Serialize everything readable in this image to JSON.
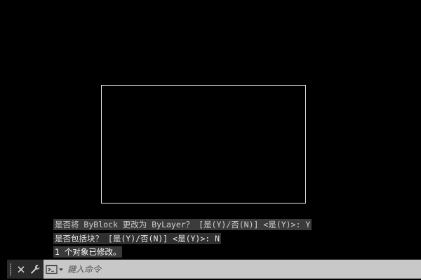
{
  "history": [
    "是否将 ByBlock 更改为 ByLayer？ [是(Y)/否(N)] <是(Y)>: Y",
    "是否包括块？ [是(Y)/否(N)] <是(Y)>: N",
    "1 个对象已修改。"
  ],
  "command_bar": {
    "close_icon": "close-icon",
    "customize_icon": "wrench-icon",
    "prompt_icon": "command-prompt-icon",
    "placeholder": "鍵入命令"
  },
  "colors": {
    "drawing_background": "#000000",
    "rectangle_stroke": "#e6e6e6",
    "command_bar": "#2b2b2b",
    "input_background": "#c8c8c8"
  }
}
